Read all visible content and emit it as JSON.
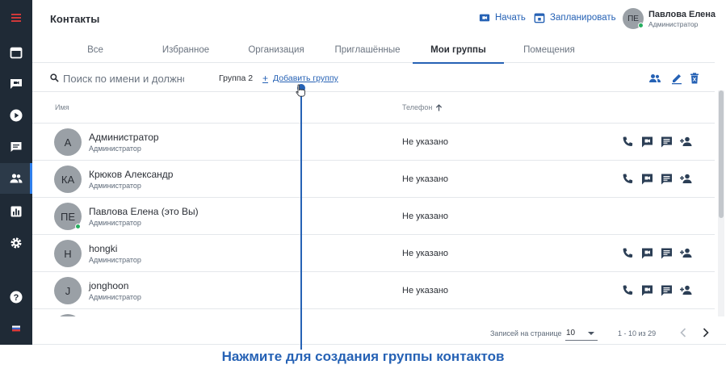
{
  "header": {
    "title": "Контакты",
    "start_label": "Начать",
    "schedule_label": "Запланировать",
    "user": {
      "initials": "ПЕ",
      "name": "Павлова Елена",
      "role": "Администратор"
    }
  },
  "sidebar": {
    "items": [
      {
        "name": "menu-icon"
      },
      {
        "name": "calendar-icon"
      },
      {
        "name": "conference-icon"
      },
      {
        "name": "play-icon"
      },
      {
        "name": "chat-icon"
      },
      {
        "name": "contacts-icon",
        "active": true
      },
      {
        "name": "stats-icon"
      },
      {
        "name": "settings-icon"
      },
      {
        "name": "help-icon"
      },
      {
        "name": "language-flag-icon"
      }
    ]
  },
  "tabs": [
    "Все",
    "Избранное",
    "Организация",
    "Приглашённые",
    "Мои группы",
    "Помещения"
  ],
  "active_tab": "Мои группы",
  "toolbar": {
    "search_placeholder": "Поиск по имени и должности",
    "group_name": "Группа 2",
    "add_group_label": "Добавить группу"
  },
  "table": {
    "col_name": "Имя",
    "col_phone": "Телефон",
    "rows": [
      {
        "initials": "А",
        "name": "Администратор",
        "role": "Администратор",
        "phone": "Не указано"
      },
      {
        "initials": "КА",
        "name": "Крюков Александр",
        "role": "Администратор",
        "phone": "Не указано"
      },
      {
        "initials": "ПЕ",
        "name": "Павлова Елена (это Вы)",
        "role": "Администратор",
        "phone": "Не указано"
      },
      {
        "initials": "H",
        "name": "hongki",
        "role": "Администратор",
        "phone": "Не указано"
      },
      {
        "initials": "J",
        "name": "jonghoon",
        "role": "Администратор",
        "phone": "Не указано"
      }
    ]
  },
  "footer": {
    "per_page_label": "Записей на странице",
    "per_page": "10",
    "range": "1 - 10 из 29"
  },
  "caption": "Нажмите для создания группы контактов",
  "colors": {
    "accent": "#2662b5",
    "sidebar": "#1f2a36",
    "online": "#27ae60",
    "menu_accent": "#e03a3a"
  }
}
